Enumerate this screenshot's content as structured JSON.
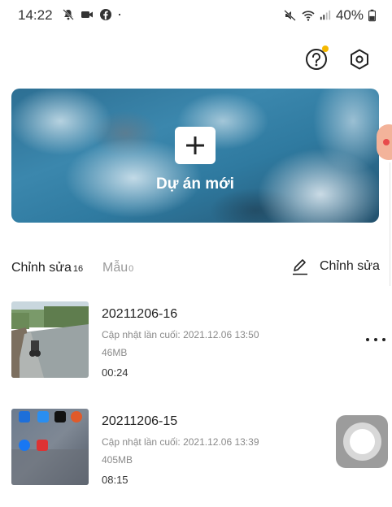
{
  "status_bar": {
    "time": "14:22",
    "left_icons": [
      "notifications-off-icon",
      "video-camera-icon",
      "facebook-icon",
      "dot-icon"
    ],
    "right_icons": [
      "mute-icon",
      "wifi-icon",
      "signal-icon"
    ],
    "battery": "40%"
  },
  "header": {
    "icons": [
      "help-icon",
      "settings-icon"
    ],
    "help_badge_color": "#f5b800"
  },
  "banner": {
    "label": "Dự án mới",
    "icon": "plus-icon"
  },
  "tabs": [
    {
      "label": "Chỉnh sửa",
      "count": "16",
      "active": true
    },
    {
      "label": "Mẫu",
      "count": "0",
      "active": false
    }
  ],
  "edit_action": {
    "label": "Chỉnh sửa",
    "icon": "pencil-icon"
  },
  "projects": [
    {
      "title": "20211206-16",
      "updated": "Cập nhật lần cuối: 2021.12.06 13:50",
      "size": "46MB",
      "duration": "00:24"
    },
    {
      "title": "20211206-15",
      "updated": "Cập nhật lần cuối: 2021.12.06 13:39",
      "size": "405MB",
      "duration": "08:15"
    }
  ],
  "colors": {
    "accent_badge": "#f5b800",
    "banner": "#2f7aa0"
  }
}
